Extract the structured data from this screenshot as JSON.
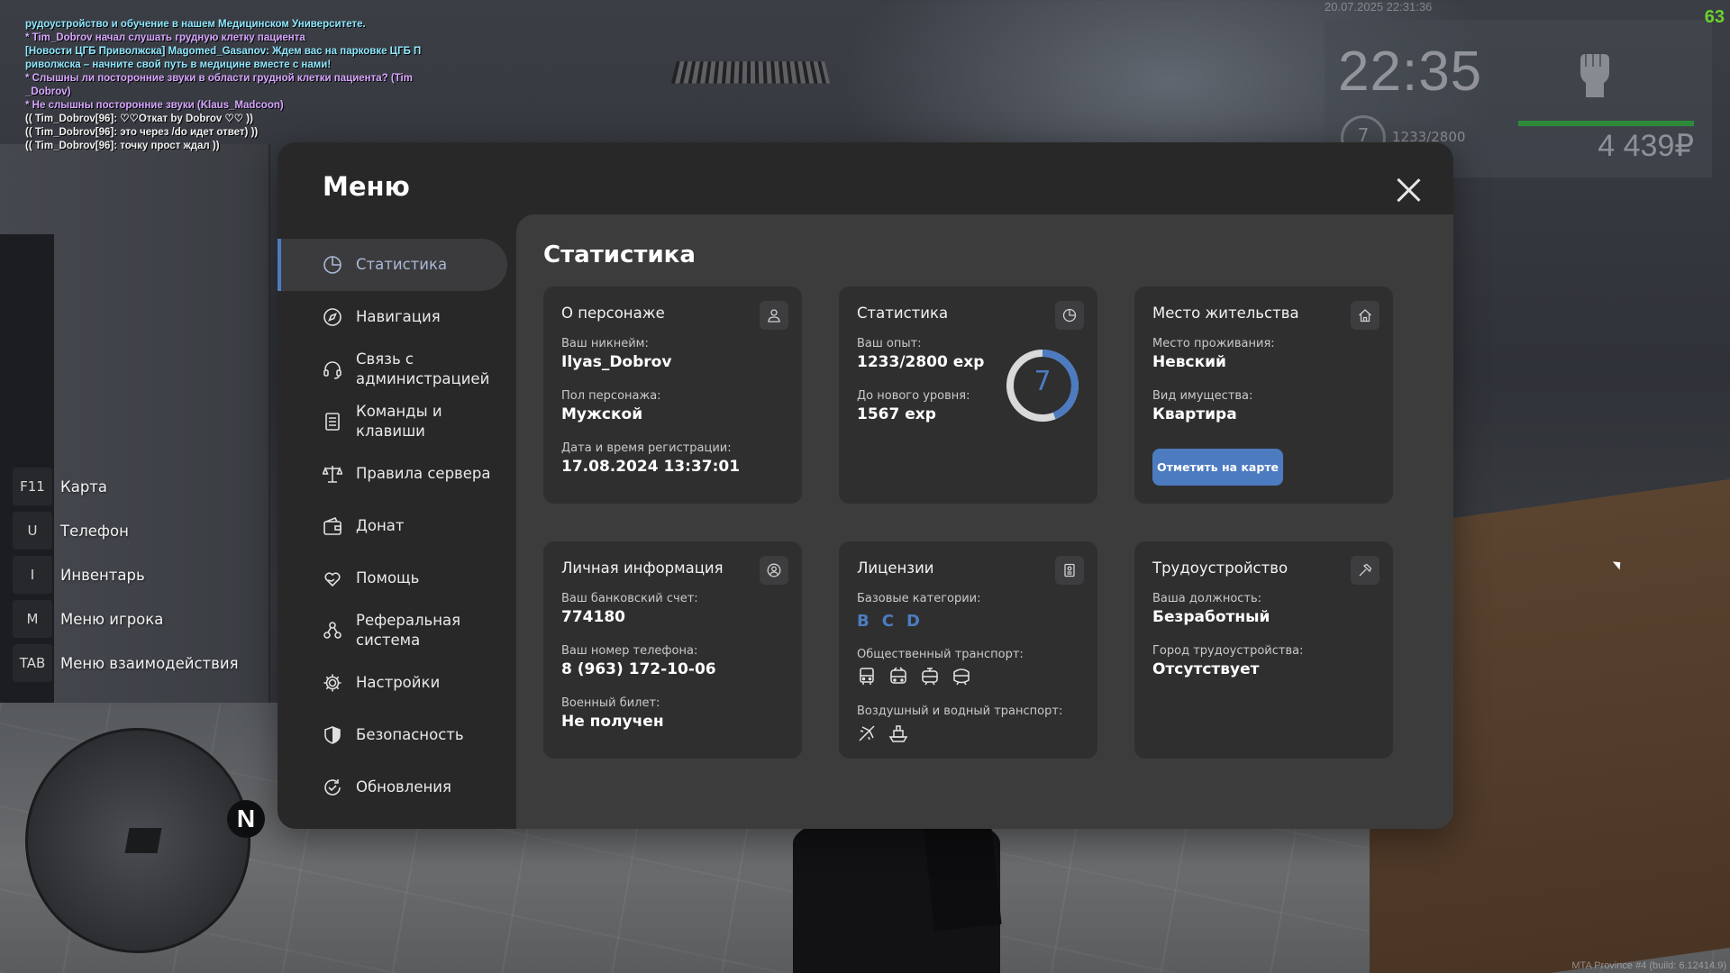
{
  "chat": [
    {
      "text": "рудоустройство и обучение в нашем Медицинском Университете.",
      "color": "#8fe8ff"
    },
    {
      "text": "* Tim_Dobrov начал слушать грудную клетку пациента",
      "color": "#d8a6ff"
    },
    {
      "text": "[Новости ЦГБ Приволжска] Magomed_Gasanov: Ждем вас на парковке ЦГБ П",
      "color": "#8fe8ff"
    },
    {
      "text": "риволжска – начните свой путь в медицине вместе с нами!",
      "color": "#8fe8ff"
    },
    {
      "text": "* Слышны ли посторонние звуки в области грудной клетки пациента? (Tim",
      "color": "#d8a6ff"
    },
    {
      "text": "_Dobrov)",
      "color": "#d8a6ff"
    },
    {
      "text": "* Не слышны посторонние звуки (Klaus_Madcoon)",
      "color": "#d8a6ff"
    },
    {
      "text": "(( Tim_Dobrov[96]: ♡♡Откат by Dobrov ♡♡ ))",
      "color": "#f0f0f0"
    },
    {
      "text": "(( Tim_Dobrov[96]: это через /do идет ответ) ))",
      "color": "#f0f0f0"
    },
    {
      "text": "(( Tim_Dobrov[96]: точку прост ждал ))",
      "color": "#f0f0f0"
    }
  ],
  "hud": {
    "datetime": "20.07.2025 22:31:36",
    "fps": "63",
    "time": "22:35",
    "level": "7",
    "exp": "1233/2800",
    "money": "4 439₽",
    "fist_icon": "fist-icon"
  },
  "hotkeys": [
    {
      "key": "F11",
      "label": "Карта"
    },
    {
      "key": "U",
      "label": "Телефон"
    },
    {
      "key": "I",
      "label": "Инвентарь"
    },
    {
      "key": "M",
      "label": "Меню игрока"
    },
    {
      "key": "TAB",
      "label": "Меню взаимодействия"
    }
  ],
  "radar": {
    "north": "N"
  },
  "build": "MTA Province #4 (build: 6.12414.9)",
  "menu": {
    "title": "Меню",
    "nav": [
      {
        "label": "Статистика",
        "icon": "pie-chart-icon",
        "active": true
      },
      {
        "label": "Навигация",
        "icon": "compass-icon"
      },
      {
        "label": "Связь с администрацией",
        "icon": "headset-icon"
      },
      {
        "label": "Команды и клавиши",
        "icon": "document-list-icon"
      },
      {
        "label": "Правила сервера",
        "icon": "scales-icon"
      },
      {
        "label": "Донат",
        "icon": "wallet-icon"
      },
      {
        "label": "Помощь",
        "icon": "heart-hand-icon"
      },
      {
        "label": "Реферальная система",
        "icon": "people-network-icon"
      },
      {
        "label": "Настройки",
        "icon": "gear-icon"
      },
      {
        "label": "Безопасность",
        "icon": "shield-icon"
      },
      {
        "label": "Обновления",
        "icon": "refresh-check-icon"
      }
    ],
    "accent": "#4d7bc0"
  },
  "stats": {
    "title": "Статистика",
    "character": {
      "title": "О персонаже",
      "icon": "user-icon",
      "nick_label": "Ваш никнейм:",
      "nick": "Ilyas_Dobrov",
      "sex_label": "Пол персонажа:",
      "sex": "Мужской",
      "reg_label": "Дата и время регистрации:",
      "reg": "17.08.2024 13:37:01"
    },
    "statistics": {
      "title": "Статистика",
      "icon": "pie-chart-icon",
      "exp_label": "Ваш опыт:",
      "exp": "1233/2800 exp",
      "next_label": "До нового уровня:",
      "next": "1567 exp",
      "level": "7",
      "progress": 0.44
    },
    "residence": {
      "title": "Место жительства",
      "icon": "house-icon",
      "place_label": "Место проживания:",
      "place": "Невский",
      "type_label": "Вид имущества:",
      "type": "Квартира",
      "button": "Отметить на карте"
    },
    "personal": {
      "title": "Личная информация",
      "icon": "user-circle-icon",
      "bank_label": "Ваш банковский счет:",
      "bank": "774180",
      "phone_label": "Ваш номер телефона:",
      "phone": "8 (963) 172-10-06",
      "military_label": "Военный билет:",
      "military": "Не получен"
    },
    "licenses": {
      "title": "Лицензии",
      "icon": "id-card-icon",
      "base_label": "Базовые категории:",
      "categories": [
        "B",
        "C",
        "D"
      ],
      "public_label": "Общественный транспорт:",
      "public_icons": [
        "bus-icon",
        "trolleybus-icon",
        "tram-icon",
        "metro-icon"
      ],
      "air_label": "Воздушный и водный транспорт:",
      "air_icons": [
        "plane-icon",
        "boat-icon"
      ]
    },
    "employment": {
      "title": "Трудоустройство",
      "icon": "hammer-icon",
      "position_label": "Ваша должность:",
      "position": "Безработный",
      "city_label": "Город трудоустройства:",
      "city": "Отсутствует"
    }
  }
}
